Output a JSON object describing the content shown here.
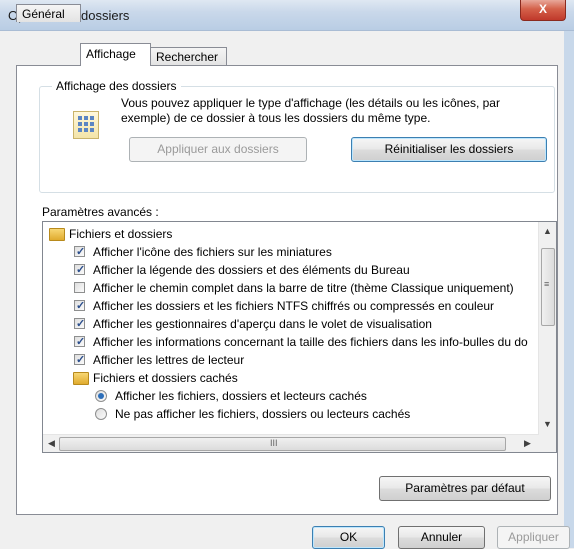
{
  "window": {
    "title": "Options des dossiers",
    "close_label": "X"
  },
  "tabs": [
    {
      "label": "Général"
    },
    {
      "label": "Affichage"
    },
    {
      "label": "Rechercher"
    }
  ],
  "folder_view": {
    "group_title": "Affichage des dossiers",
    "description": "Vous pouvez appliquer le type d'affichage (les détails ou les icônes, par exemple) de ce dossier à tous les dossiers du même type.",
    "apply_button": "Appliquer aux dossiers",
    "reset_button": "Réinitialiser les dossiers"
  },
  "advanced": {
    "label": "Paramètres avancés :",
    "items": [
      {
        "kind": "folder",
        "label": "Fichiers et dossiers"
      },
      {
        "kind": "checkbox",
        "checked": true,
        "label": "Afficher l'icône des fichiers sur les miniatures"
      },
      {
        "kind": "checkbox",
        "checked": true,
        "label": "Afficher la légende des dossiers et des éléments du Bureau"
      },
      {
        "kind": "checkbox",
        "checked": false,
        "label": "Afficher le chemin complet dans la barre de titre (thème Classique uniquement)"
      },
      {
        "kind": "checkbox",
        "checked": true,
        "label": "Afficher les dossiers et les fichiers NTFS chiffrés ou compressés en couleur"
      },
      {
        "kind": "checkbox",
        "checked": true,
        "label": "Afficher les gestionnaires d'aperçu dans le volet de visualisation"
      },
      {
        "kind": "checkbox",
        "checked": true,
        "label": "Afficher les informations concernant la taille des fichiers dans les info-bulles du do"
      },
      {
        "kind": "checkbox",
        "checked": true,
        "label": "Afficher les lettres de lecteur"
      },
      {
        "kind": "folder",
        "label": "Fichiers et dossiers cachés"
      },
      {
        "kind": "radio",
        "checked": true,
        "label": "Afficher les fichiers, dossiers et lecteurs cachés"
      },
      {
        "kind": "radio",
        "checked": false,
        "label": "Ne pas afficher les fichiers, dossiers ou lecteurs cachés"
      }
    ],
    "scroll_up": "▲",
    "scroll_down": "▼",
    "scroll_left": "◀",
    "scroll_right": "▶",
    "hgrip": "III",
    "vgrip": "≡"
  },
  "defaults_button": "Paramètres par défaut",
  "footer": {
    "ok": "OK",
    "cancel": "Annuler",
    "apply": "Appliquer"
  }
}
